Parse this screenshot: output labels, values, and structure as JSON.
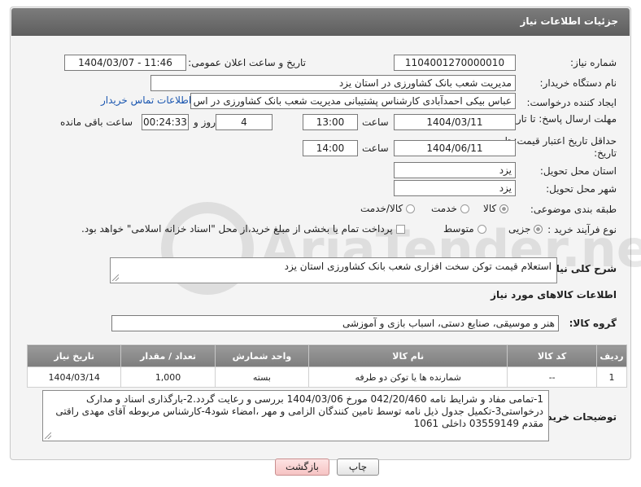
{
  "panel": {
    "title": "جزئیات اطلاعات نیاز"
  },
  "form": {
    "need_number_label": "شماره نیاز:",
    "need_number": "1104001270000010",
    "announce_label": "تاریخ و ساعت اعلان عمومی:",
    "announce_value": "1404/03/07 - 11:46",
    "buyer_org_label": "نام دستگاه خریدار:",
    "buyer_org": "مدیریت شعب بانک کشاورزی در استان یزد",
    "creator_label": "ایجاد کننده درخواست:",
    "creator": "عباس بیکی احمدآبادی کارشناس پشتیبانی مدیریت شعب بانک کشاورزی در اس",
    "buyer_contact_link": "اطلاعات تماس خریدار",
    "deadline_label": "مهلت ارسال پاسخ: تا تاریخ:",
    "deadline_date": "1404/03/11",
    "time_label": "ساعت",
    "deadline_time": "13:00",
    "days_value": "4",
    "days_label": "روز و",
    "remaining_time": "00:24:33",
    "remaining_label": "ساعت باقی مانده",
    "price_validity_label": "حداقل تاریخ اعتبار قیمت: تا تاریخ:",
    "price_validity_date": "1404/06/11",
    "price_validity_time": "14:00",
    "province_label": "استان محل تحویل:",
    "province": "یزد",
    "city_label": "شهر محل تحویل:",
    "city": "یزد",
    "category_label": "طبقه بندی موضوعی:",
    "category_options": [
      "کالا",
      "خدمت",
      "کالا/خدمت"
    ],
    "process_label": "نوع فرآیند خرید :",
    "process_options": [
      "جزیی",
      "متوسط"
    ],
    "payment_note": "پرداخت تمام یا بخشی از مبلغ خرید،از محل \"اسناد خزانه اسلامی\" خواهد بود."
  },
  "summary": {
    "label": "شرح کلی نیاز:",
    "text": "استعلام قیمت توکن سخت افزاری شعب بانک کشاورزی استان یزد"
  },
  "goods": {
    "section_title": "اطلاعات کالاهای مورد نیاز",
    "group_label": "گروه کالا:",
    "group_value": "هنر و موسیقی، صنایع دستی، اسباب بازی و آموزشی"
  },
  "table": {
    "headers": [
      "ردیف",
      "کد کالا",
      "نام کالا",
      "واحد شمارش",
      "تعداد / مقدار",
      "تاریخ نیاز"
    ],
    "rows": [
      [
        "1",
        "--",
        "شمارنده ها یا توکن دو طرفه",
        "بسته",
        "1,000",
        "1404/03/14"
      ]
    ]
  },
  "buyer_notes": {
    "label": "توضیحات خریدار:",
    "text": "1-تمامی مفاد و شرایط نامه 042/20/460 مورخ 1404/03/06 بررسی و رعایت گردد.2-بارگذاری اسناد و مدارک درخواستی3-تکمیل جدول ذیل نامه توسط تامین کنندگان الزامی و مهر ،امضاء شود4-کارشناس مربوطه آقای مهدی راقتی مقدم 03559149 داخلی 1061"
  },
  "buttons": {
    "print": "چاپ",
    "back": "بازگشت"
  },
  "watermark": {
    "text": "AriaTender.net"
  }
}
